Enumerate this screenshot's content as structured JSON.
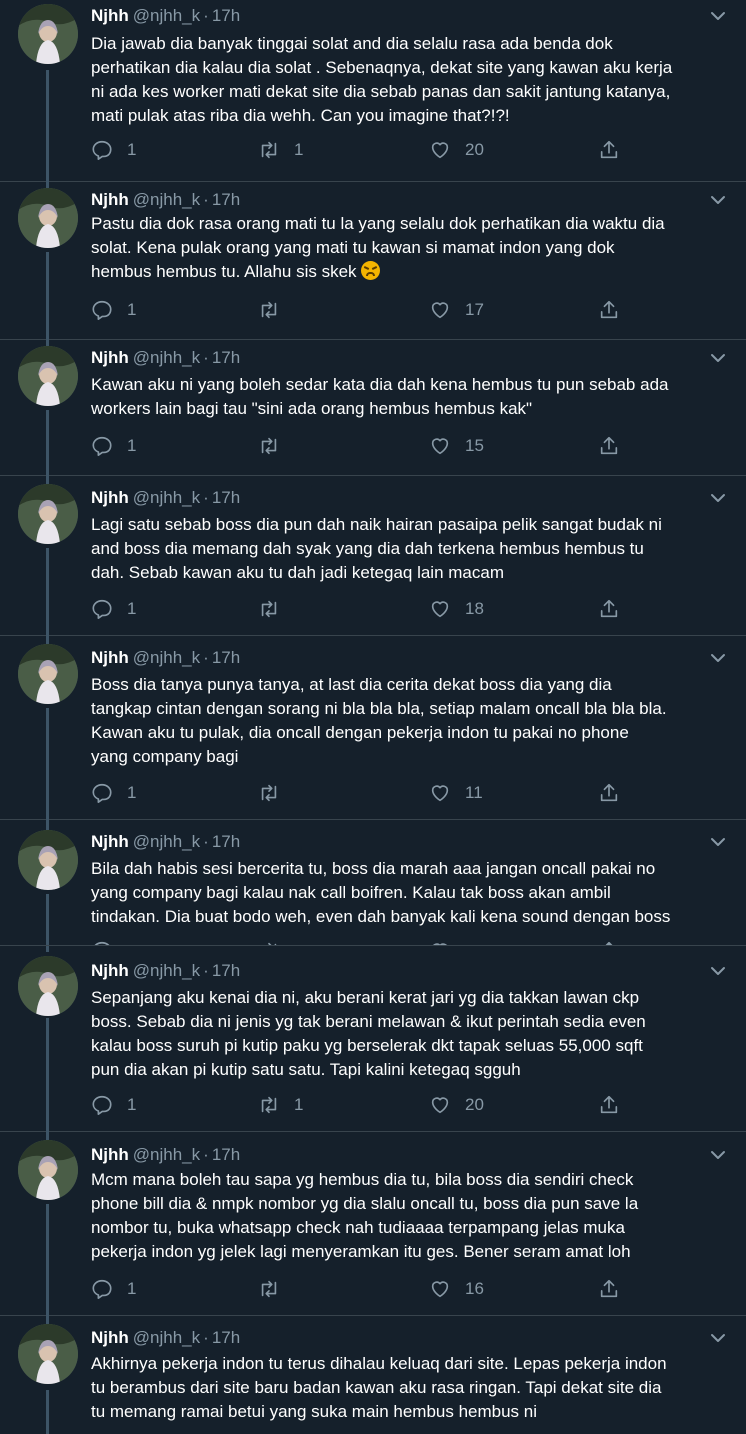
{
  "tweets": [
    {
      "name": "Njhh",
      "handle": "@njhh_k",
      "separator": "·",
      "time": "17h",
      "text": "Dia jawab dia banyak tinggai solat and dia selalu rasa ada benda dok\nperhatikan dia kalau dia solat . Sebenaqnya, dekat site yang kawan aku kerja\nni ada kes worker mati dekat site dia sebab panas dan sakit jantung katanya,\nmati pulak atas riba dia wehh. Can you imagine that?!?!",
      "replies": "1",
      "retweets": "1",
      "likes": "20"
    },
    {
      "name": "Njhh",
      "handle": "@njhh_k",
      "separator": "·",
      "time": "17h",
      "text": "Pastu dia dok rasa orang mati tu la yang selalu dok perhatikan dia waktu dia\nsolat. Kena pulak orang yang mati tu kawan si mamat indon yang dok\nhembus hembus tu. Allahu sis skek",
      "emoji": "tired-face-emoji",
      "replies": "1",
      "retweets": "",
      "likes": "17"
    },
    {
      "name": "Njhh",
      "handle": "@njhh_k",
      "separator": "·",
      "time": "17h",
      "text": "Kawan aku ni yang boleh sedar kata dia dah kena hembus tu pun sebab ada\nworkers lain bagi tau \"sini ada orang hembus hembus kak\"",
      "replies": "1",
      "retweets": "",
      "likes": "15"
    },
    {
      "name": "Njhh",
      "handle": "@njhh_k",
      "separator": "·",
      "time": "17h",
      "text": "Lagi satu sebab boss dia pun dah naik hairan pasaipa pelik sangat budak ni\nand boss dia memang dah syak yang dia dah terkena hembus hembus tu\ndah. Sebab kawan aku tu dah jadi ketegaq lain macam",
      "replies": "1",
      "retweets": "",
      "likes": "18"
    },
    {
      "name": "Njhh",
      "handle": "@njhh_k",
      "separator": "·",
      "time": "17h",
      "text": "Boss dia tanya punya tanya, at last dia cerita dekat boss dia yang dia\ntangkap cintan dengan sorang ni bla bla bla, setiap malam oncall bla bla bla.\nKawan aku tu pulak, dia oncall dengan pekerja indon tu pakai no phone\nyang company bagi",
      "replies": "1",
      "retweets": "",
      "likes": "11"
    },
    {
      "name": "Njhh",
      "handle": "@njhh_k",
      "separator": "·",
      "time": "17h",
      "text": "Bila dah habis sesi bercerita tu, boss dia marah aaa jangan oncall pakai no\nyang company bagi kalau nak call boifren. Kalau tak boss akan ambil\ntindakan. Dia buat bodo weh, even dah banyak kali kena sound dengan boss",
      "replies": "",
      "retweets": "",
      "likes": ""
    },
    {
      "name": "Njhh",
      "handle": "@njhh_k",
      "separator": "·",
      "time": "17h",
      "text": "Sepanjang aku kenai dia ni, aku berani kerat jari yg dia takkan lawan ckp\nboss. Sebab dia ni jenis yg tak berani melawan & ikut perintah sedia even\nkalau boss suruh pi kutip paku yg berselerak dkt tapak seluas 55,000 sqft\npun dia akan pi kutip satu satu. Tapi kalini ketegaq sgguh",
      "replies": "1",
      "retweets": "1",
      "likes": "20"
    },
    {
      "name": "Njhh",
      "handle": "@njhh_k",
      "separator": "·",
      "time": "17h",
      "text": "Mcm mana boleh tau sapa yg hembus dia tu, bila boss dia sendiri check\nphone bill dia & nmpk nombor yg dia slalu oncall tu, boss dia pun save la\nnombor tu, buka whatsapp check nah tudiaaaa terpampang jelas muka\npekerja indon yg jelek lagi menyeramkan itu ges. Bener seram amat loh",
      "replies": "1",
      "retweets": "",
      "likes": "16"
    },
    {
      "name": "Njhh",
      "handle": "@njhh_k",
      "separator": "·",
      "time": "17h",
      "text": "Akhirnya pekerja indon tu terus dihalau keluaq dari site. Lepas pekerja indon\ntu berambus dari site baru badan kawan aku rasa ringan. Tapi dekat site dia\ntu memang ramai betui yang suka main hembus hembus ni",
      "replies": "",
      "retweets": "",
      "likes": ""
    }
  ],
  "icons": {
    "reply": "reply-icon",
    "retweet": "retweet-icon",
    "like": "heart-icon",
    "share": "share-icon",
    "menu": "chevron-down-icon"
  },
  "colors": {
    "background": "#15202b",
    "divider": "#38444d",
    "muted_text": "#8899a6",
    "thread_line": "#3d5466"
  }
}
